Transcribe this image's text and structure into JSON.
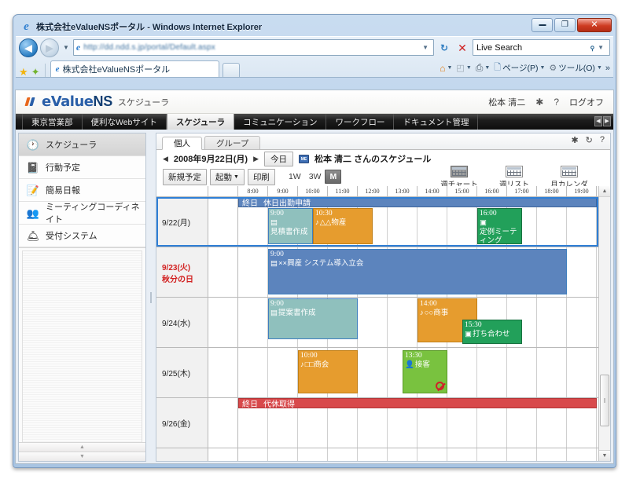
{
  "browser": {
    "title": "株式会社eValueNSポータル - Windows Internet Explorer",
    "address_value": "http://dd.ndd.s.jp/portal/Default.aspx",
    "search_value": "Live Search",
    "tab_label": "株式会社eValueNSポータル",
    "minimize_glyph": "",
    "maximize_glyph": "❐",
    "close_glyph": "✕",
    "back_glyph": "◀",
    "forward_glyph": "▶",
    "refresh_glyph": "↻",
    "stop_glyph": "✕",
    "dropdown_glyph": "▼",
    "search_glyph": "⌕",
    "commands": [
      {
        "label": "",
        "icon": "home-icon",
        "glyph": "⌂",
        "has_arrow": true
      },
      {
        "label": "",
        "icon": "feeds-icon",
        "glyph": "◰",
        "has_arrow": true
      },
      {
        "label": "",
        "icon": "print-icon",
        "glyph": "⎙",
        "has_arrow": true
      },
      {
        "label": "ページ(P)",
        "icon": "page-icon",
        "glyph": "🗋",
        "has_arrow": true
      },
      {
        "label": "ツール(O)",
        "icon": "tools-icon",
        "glyph": "⚙",
        "has_arrow": true
      }
    ],
    "overflow_glyph": "»"
  },
  "app": {
    "logo_e": "eValue",
    "logo_ns": "NS",
    "logo_sub": "スケジューラ",
    "user": "松本 清二",
    "gear_glyph": "✱",
    "help_glyph": "?",
    "logoff": "ログオフ",
    "nav_tabs": [
      {
        "label": "東京営業部",
        "active": false
      },
      {
        "label": "便利なWebサイト",
        "active": false
      },
      {
        "label": "スケジューラ",
        "active": true
      },
      {
        "label": "コミュニケーション",
        "active": false
      },
      {
        "label": "ワークフロー",
        "active": false
      },
      {
        "label": "ドキュメント管理",
        "active": false
      }
    ],
    "nav_scroll_left": "◀",
    "nav_scroll_right": "▶"
  },
  "sidebar": {
    "items": [
      {
        "label": "スケジューラ",
        "icon": "clock-icon",
        "glyph": "🕐",
        "active": true
      },
      {
        "label": "行動予定",
        "icon": "book-icon",
        "glyph": "📓",
        "active": false
      },
      {
        "label": "簡易日報",
        "icon": "report-icon",
        "glyph": "📝",
        "active": false
      },
      {
        "label": "ミーティングコーディネイト",
        "icon": "meeting-icon",
        "glyph": "👥",
        "active": false
      },
      {
        "label": "受付システム",
        "icon": "reception-icon",
        "glyph": "🛎",
        "active": false
      }
    ],
    "scroll_up": "▲",
    "scroll_down": "▼"
  },
  "scheduler": {
    "tabs": [
      {
        "label": "個人",
        "active": true
      },
      {
        "label": "グループ",
        "active": false
      }
    ],
    "panel_tools": [
      {
        "icon": "gear-icon",
        "glyph": "✱"
      },
      {
        "icon": "refresh-icon",
        "glyph": "↻"
      },
      {
        "icon": "help-icon",
        "glyph": "?"
      }
    ],
    "prev_glyph": "◀",
    "next_glyph": "▶",
    "date": "2008年9月22日(月)",
    "today_button": "今日",
    "title": "松本 清二 さんのスケジュール",
    "buttons": [
      {
        "label": "新規予定",
        "name": "new-schedule-button"
      },
      {
        "label": "起動",
        "name": "launch-button",
        "arrow": "▼"
      },
      {
        "label": "印刷",
        "name": "print-button"
      }
    ],
    "week_modes": [
      {
        "label": "1W",
        "selected": false
      },
      {
        "label": "3W",
        "selected": false
      },
      {
        "label": "M",
        "selected": true
      }
    ],
    "view_modes": [
      {
        "label": "週チャート",
        "selected": true
      },
      {
        "label": "週リスト",
        "selected": false
      },
      {
        "label": "月カレンダー",
        "selected": false
      }
    ],
    "time_slots": [
      "8:00",
      "9:00",
      "10:00",
      "11:00",
      "12:00",
      "13:00",
      "14:00",
      "15:00",
      "16:00",
      "17:00",
      "18:00",
      "19:00"
    ],
    "allday_label": "終日",
    "rows": [
      {
        "date": "9/22(月)",
        "holiday_label": "",
        "is_holiday": false,
        "selected": true,
        "allday": {
          "text": "休日出勤申請",
          "color": "blue"
        },
        "events": [
          {
            "time": "9:00",
            "title": "見積書作成",
            "color": "teal",
            "start": 1,
            "span": 1.5,
            "icon": "doc-icon"
          },
          {
            "time": "10:30",
            "title": "△△物産",
            "color": "orange",
            "start": 2.5,
            "span": 2,
            "icon": "phone-icon"
          },
          {
            "time": "16:00",
            "title": "定例ミーティング",
            "color": "green",
            "start": 8,
            "span": 1.5,
            "icon": "meeting-icon"
          }
        ]
      },
      {
        "date": "9/23(火)",
        "holiday_label": "秋分の日",
        "is_holiday": true,
        "selected": false,
        "allday": null,
        "events": [
          {
            "time": "9:00",
            "title": "××興産 システム導入立会",
            "color": "blue",
            "start": 1,
            "span": 10,
            "icon": "doc-icon"
          }
        ]
      },
      {
        "date": "9/24(水)",
        "holiday_label": "",
        "is_holiday": false,
        "selected": false,
        "allday": null,
        "events": [
          {
            "time": "9:00",
            "title": "提案書作成",
            "color": "teal",
            "start": 1,
            "span": 3,
            "icon": "doc-icon"
          },
          {
            "time": "14:00",
            "title": "○○商事",
            "color": "orange",
            "start": 6,
            "span": 2,
            "icon": "phone-icon"
          },
          {
            "time": "15:30",
            "title": "打ち合わせ",
            "color": "green",
            "start": 7.5,
            "span": 2,
            "icon": "meeting-icon"
          }
        ]
      },
      {
        "date": "9/25(木)",
        "holiday_label": "",
        "is_holiday": false,
        "selected": false,
        "allday": null,
        "events": [
          {
            "time": "10:00",
            "title": "□□商会",
            "color": "orange",
            "start": 2,
            "span": 2,
            "icon": "phone-icon"
          },
          {
            "time": "13:30",
            "title": "接客",
            "color": "lgreen",
            "start": 5.5,
            "span": 2,
            "icon": "person-icon",
            "restricted": true
          }
        ]
      },
      {
        "date": "9/26(金)",
        "holiday_label": "",
        "is_holiday": false,
        "selected": false,
        "allday": {
          "text": "代休取得",
          "color": "red"
        },
        "events": []
      }
    ],
    "scroll_up": "▲",
    "scroll_down": "▼"
  },
  "colors": {
    "accent_blue": "#5c84bd",
    "holiday_red": "#d22020",
    "allday_red": "#d8494b",
    "event_teal": "#8fc0bd",
    "event_orange": "#e69c2e",
    "event_green": "#22a05a",
    "event_lightgreen": "#79c23f"
  }
}
